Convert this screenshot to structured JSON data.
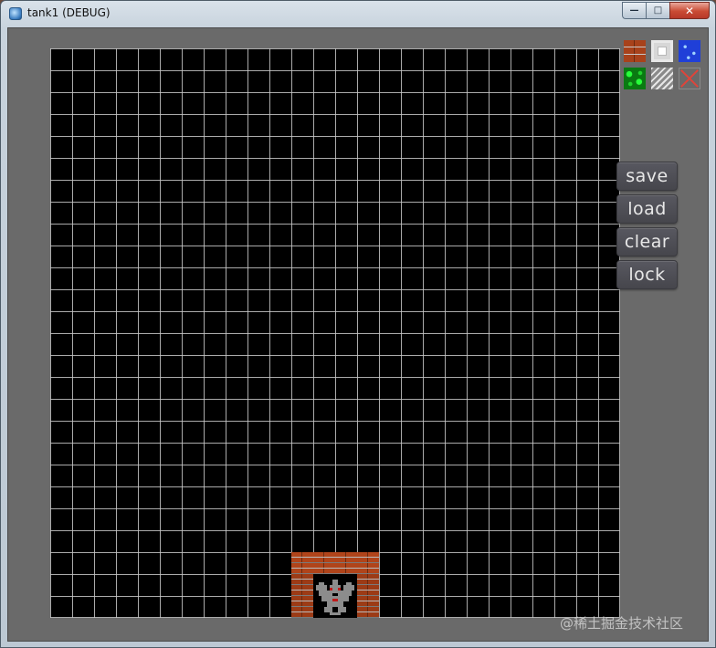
{
  "window": {
    "title": "tank1 (DEBUG)",
    "controls": {
      "minimize": "—",
      "maximize": "□",
      "close": "✕"
    }
  },
  "editor": {
    "grid": {
      "cols": 26,
      "rows": 26
    },
    "palette": [
      {
        "name": "brick",
        "icon": "brick-wall-icon"
      },
      {
        "name": "steel",
        "icon": "steel-wall-icon"
      },
      {
        "name": "water",
        "icon": "water-icon"
      },
      {
        "name": "grass",
        "icon": "grass-icon"
      },
      {
        "name": "ice",
        "icon": "ice-icon"
      },
      {
        "name": "eraser",
        "icon": "erase-x-icon"
      }
    ],
    "buttons": {
      "save": "save",
      "load": "load",
      "clear": "clear",
      "lock": "lock"
    },
    "base": {
      "icon": "eagle-icon"
    }
  },
  "watermark": "@稀土掘金技术社区",
  "colors": {
    "grid_line": "#c8c8c8",
    "background": "#6a6a6a",
    "brick": "#9c3b16"
  }
}
